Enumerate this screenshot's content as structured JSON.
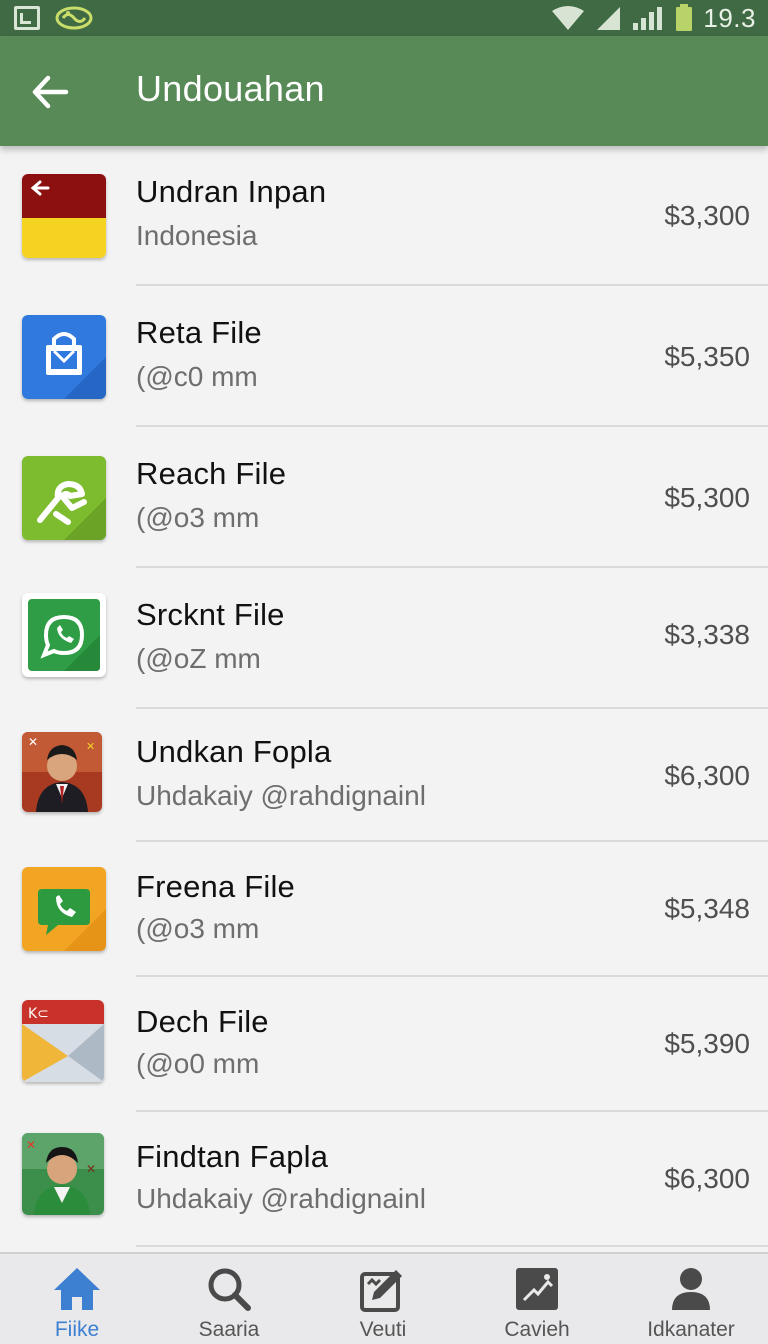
{
  "status_bar": {
    "time": "19.3",
    "icons": [
      "screenshot-icon",
      "app-logo-icon",
      "wifi-icon",
      "signal-icon",
      "battery-icon"
    ]
  },
  "app_bar": {
    "title": "Undouahan",
    "back_icon": "arrow-left-icon"
  },
  "items": [
    {
      "title": "Undran Inpan",
      "subtitle": "Indonesia",
      "price": "$3,300",
      "icon": "indonesia-flag-icon"
    },
    {
      "title": "Reta File",
      "subtitle": "(@c0 mm",
      "price": "$5,350",
      "icon": "shopping-bag-icon"
    },
    {
      "title": "Reach File",
      "subtitle": "(@o3 mm",
      "price": "$5,300",
      "icon": "handshake-icon"
    },
    {
      "title": "Srcknt File",
      "subtitle": "(@oZ mm",
      "price": "$3,338",
      "icon": "whatsapp-icon"
    },
    {
      "title": "Undkan Fopla",
      "subtitle": "Uhdakaiy @rahdignainl",
      "price": "$6,300",
      "icon": "portrait-icon"
    },
    {
      "title": "Freena File",
      "subtitle": "(@o3 mm",
      "price": "$5,348",
      "icon": "phone-chat-icon"
    },
    {
      "title": "Dech File",
      "subtitle": "(@o0 mm",
      "price": "$5,390",
      "icon": "envelope-icon"
    },
    {
      "title": "Findtan Fapla",
      "subtitle": "Uhdakaiy @rahdignainl",
      "price": "$6,300",
      "icon": "portrait-green-icon"
    }
  ],
  "nav": [
    {
      "label": "Fiike",
      "icon": "home-icon",
      "active": true
    },
    {
      "label": "Saaria",
      "icon": "search-icon",
      "active": false
    },
    {
      "label": "Veuti",
      "icon": "edit-icon",
      "active": false
    },
    {
      "label": "Cavieh",
      "icon": "photo-icon",
      "active": false
    },
    {
      "label": "Idkanater",
      "icon": "person-icon",
      "active": false
    }
  ],
  "colors": {
    "status_bar": "#3f6a43",
    "app_bar": "#578a56",
    "nav_active": "#3d7fd1"
  }
}
